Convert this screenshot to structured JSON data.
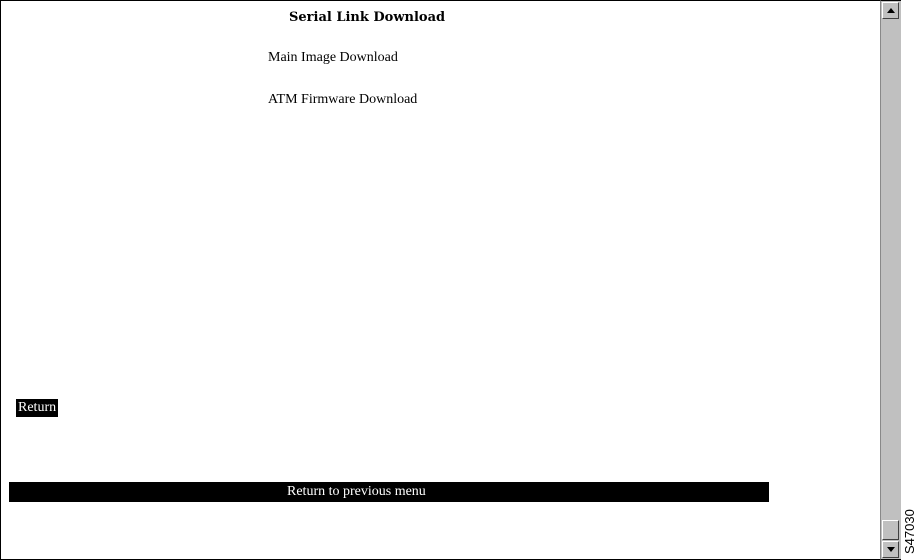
{
  "screen": {
    "title": "Serial Link Download",
    "menu_items": [
      "Main Image Download",
      "ATM Firmware Download"
    ],
    "selected_item": "Return",
    "status_message": "Return to previous menu"
  },
  "figure_id": "S47030",
  "colors": {
    "background": "#ffffff",
    "highlight_bg": "#000000",
    "highlight_fg": "#ffffff",
    "scrollbar": "#c0c0c0"
  },
  "icons": {
    "scroll_up": "up-arrow-icon",
    "scroll_down": "down-arrow-icon"
  }
}
